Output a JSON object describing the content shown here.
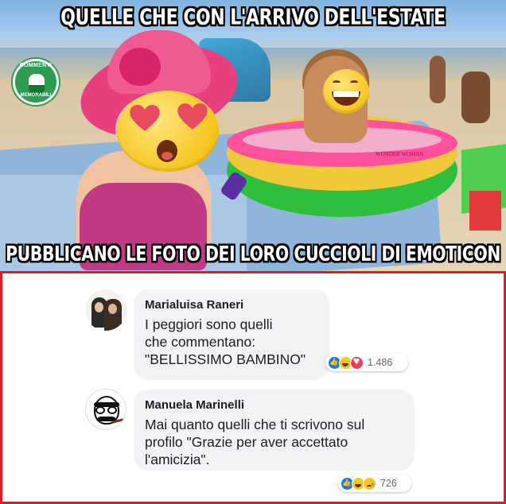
{
  "meme": {
    "top_caption": "QUELLE CHE CON L'ARRIVO DELL'ESTATE",
    "bottom_caption": "PUBBLICANO LE FOTO DEI LORO CUCCIOLI DI EMOTICON",
    "logo_top_text": "COMMENTI",
    "logo_bottom_text": "MEMORABILI",
    "pool_label": "WONDER WOMAN",
    "emojis": [
      "heart-eyes-emoji",
      "grinning-emoji"
    ]
  },
  "comments": [
    {
      "author": "Marialuisa Raneri",
      "text": "I peggiori sono quelli\nche commentano:\n\"BELLISSIMO BAMBINO\"",
      "reactions": [
        "like",
        "haha",
        "love"
      ],
      "reaction_count": "1.486"
    },
    {
      "author": "Manuela Marinelli",
      "text": "Mai quanto quelli che ti scrivono sul\nprofilo \"Grazie per aver accettato\nl'amicizia\".",
      "reactions": [
        "like",
        "haha",
        "sad"
      ],
      "reaction_count": "726"
    }
  ],
  "colors": {
    "panel_border": "#e11b22",
    "bubble_bg": "#f2f3f5",
    "like_blue": "#1877f2",
    "love_red": "#f33e58",
    "haha_yellow": "#f7c51e"
  }
}
